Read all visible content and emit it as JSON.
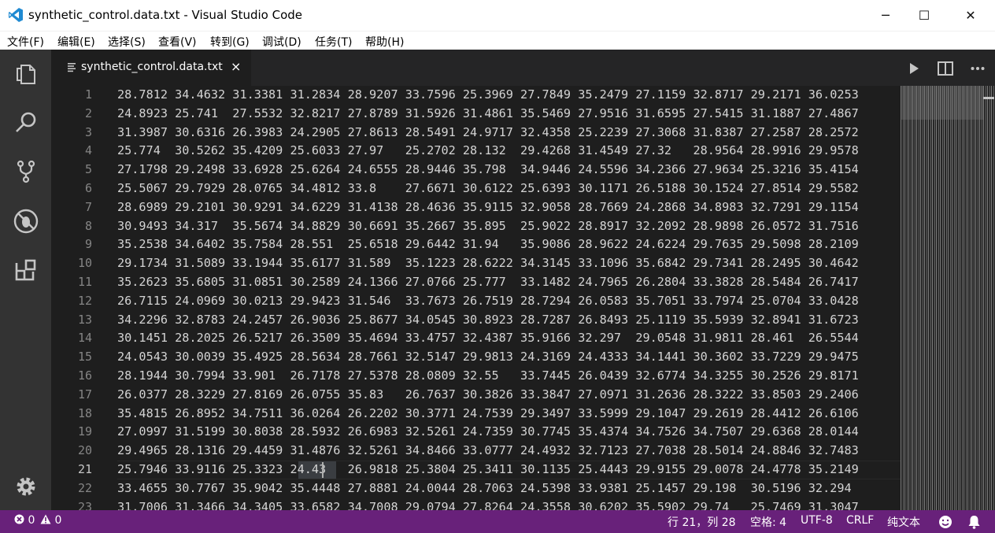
{
  "window": {
    "title": "synthetic_control.data.txt - Visual Studio Code",
    "minimize_glyph": "─",
    "maximize_glyph": "☐",
    "close_glyph": "✕"
  },
  "menu": [
    "文件(F)",
    "编辑(E)",
    "选择(S)",
    "查看(V)",
    "转到(G)",
    "调试(D)",
    "任务(T)",
    "帮助(H)"
  ],
  "activity_bar": [
    "files-icon",
    "search-icon",
    "source-control-icon",
    "debug-icon",
    "extensions-icon",
    "gear-icon"
  ],
  "tab": {
    "label": "synthetic_control.data.txt",
    "close": "×"
  },
  "toolbar": [
    "run-icon",
    "split-editor-icon",
    "more-icon"
  ],
  "editor": {
    "line_numbers": [
      "1",
      "2",
      "3",
      "4",
      "5",
      "6",
      "7",
      "8",
      "9",
      "10",
      "11",
      "12",
      "13",
      "14",
      "15",
      "16",
      "17",
      "18",
      "19",
      "20",
      "21",
      "22",
      "23"
    ],
    "active_line": 21,
    "lines": [
      "28.7812 34.4632 31.3381 31.2834 28.9207 33.7596 25.3969 27.7849 35.2479 27.1159 32.8717 29.2171 36.0253",
      "24.8923 25.741  27.5532 32.8217 27.8789 31.5926 31.4861 35.5469 27.9516 31.6595 27.5415 31.1887 27.4867",
      "31.3987 30.6316 26.3983 24.2905 27.8613 28.5491 24.9717 32.4358 25.2239 27.3068 31.8387 27.2587 28.2572",
      "25.774  30.5262 35.4209 25.6033 27.97   25.2702 28.132  29.4268 31.4549 27.32   28.9564 28.9916 29.9578",
      "27.1798 29.2498 33.6928 25.6264 24.6555 28.9446 35.798  34.9446 24.5596 34.2366 27.9634 25.3216 35.4154",
      "25.5067 29.7929 28.0765 34.4812 33.8    27.6671 30.6122 25.6393 30.1171 26.5188 30.1524 27.8514 29.5582",
      "28.6989 29.2101 30.9291 34.6229 31.4138 28.4636 35.9115 32.9058 28.7669 24.2868 34.8983 32.7291 29.1154",
      "30.9493 34.317  35.5674 34.8829 30.6691 35.2667 35.895  25.9022 28.8917 32.2092 28.9898 26.0572 31.7516",
      "35.2538 34.6402 35.7584 28.551  25.6518 29.6442 31.94   35.9086 28.9622 24.6224 29.7635 29.5098 28.2109",
      "29.1734 31.5089 33.1944 35.6177 31.589  35.1223 28.6222 34.3145 33.1096 35.6842 29.7341 28.2495 30.4642",
      "35.2623 35.6805 31.0851 30.2589 24.1366 27.0766 25.777  33.1482 24.7965 26.2804 33.3828 28.5484 26.7417",
      "26.7115 24.0969 30.0213 29.9423 31.546  33.7673 26.7519 28.7294 26.0583 35.7051 33.7974 25.0704 33.0428",
      "34.2296 32.8783 24.2457 26.9036 25.8677 34.0545 30.8923 28.7287 26.8493 25.1119 35.5939 32.8941 31.6723",
      "30.1451 28.2025 26.5217 26.3509 35.4694 33.4757 32.4387 35.9166 32.297  29.0548 31.9811 28.461  26.5544",
      "24.0543 30.0039 35.4925 28.5634 28.7661 32.5147 29.9813 24.3169 24.4333 34.1441 30.3602 33.7229 29.9475",
      "28.1944 30.7994 33.901  26.7178 27.5378 28.0809 32.55   33.7445 26.0439 32.6774 34.3255 30.2526 29.8171",
      "26.0377 28.3229 27.8169 26.0755 35.83   26.7637 30.3826 33.3847 27.0971 31.2636 28.3222 33.8503 29.2406",
      "35.4815 26.8952 34.7511 36.0264 26.2202 30.3771 24.7539 29.3497 33.5999 29.1047 29.2619 28.4412 26.6106",
      "27.0997 31.5199 30.8038 28.5932 26.6983 32.5261 24.7359 30.7745 35.4374 34.7526 34.7507 29.6368 28.0144",
      "29.4965 28.1316 29.4459 31.4876 32.5261 34.8466 33.0777 24.4932 32.7123 27.7038 28.5014 24.8846 32.7483",
      "25.7946 33.9116 25.3323 24.43   26.9818 25.3804 25.3411 30.1135 25.4443 29.9155 29.0078 24.4778 35.2149",
      "33.4655 30.7767 35.9042 35.4448 27.8881 24.0044 28.7063 24.5398 33.9381 25.1457 29.198  30.5196 32.294",
      "31.7006 31.3466 34.3405 33.6582 34.7008 29.0794 27.8264 24.3558 30.6202 35.5902 29.74   25.7469 31.3047"
    ]
  },
  "status": {
    "errors": "0",
    "warnings": "0",
    "position": "行 21，列 28",
    "indent": "空格: 4",
    "encoding": "UTF-8",
    "eol": "CRLF",
    "language": "纯文本",
    "accent_color": "#68217a"
  }
}
